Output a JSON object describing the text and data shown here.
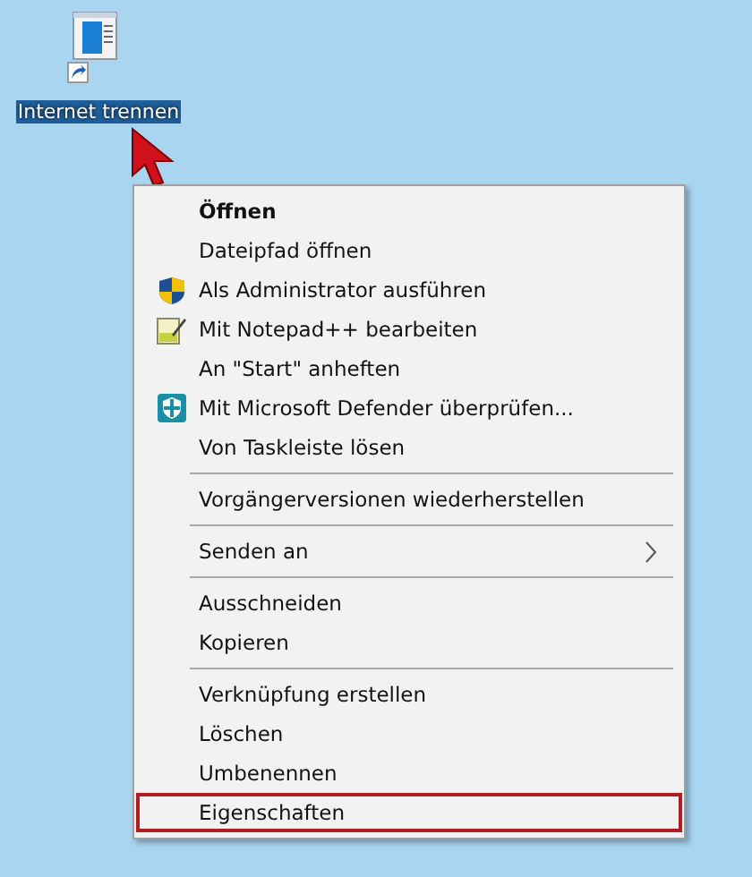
{
  "desktop_icon": {
    "label": "Internet trennen",
    "selected": true
  },
  "context_menu": {
    "groups": [
      [
        {
          "label": "Öffnen",
          "default": true,
          "kind": "plain",
          "submenu": false,
          "highlighted": false
        },
        {
          "label": "Dateipfad öffnen",
          "default": false,
          "kind": "plain",
          "submenu": false,
          "highlighted": false
        },
        {
          "label": "Als Administrator ausführen",
          "default": false,
          "kind": "shield",
          "submenu": false,
          "highlighted": false
        },
        {
          "label": "Mit Notepad++ bearbeiten",
          "default": false,
          "kind": "notepad",
          "submenu": false,
          "highlighted": false
        },
        {
          "label": "An \"Start\" anheften",
          "default": false,
          "kind": "plain",
          "submenu": false,
          "highlighted": false
        },
        {
          "label": "Mit Microsoft Defender überprüfen...",
          "default": false,
          "kind": "defender",
          "submenu": false,
          "highlighted": false
        },
        {
          "label": "Von Taskleiste lösen",
          "default": false,
          "kind": "plain",
          "submenu": false,
          "highlighted": false
        }
      ],
      [
        {
          "label": "Vorgängerversionen wiederherstellen",
          "default": false,
          "kind": "plain",
          "submenu": false,
          "highlighted": false
        }
      ],
      [
        {
          "label": "Senden an",
          "default": false,
          "kind": "plain",
          "submenu": true,
          "highlighted": false
        }
      ],
      [
        {
          "label": "Ausschneiden",
          "default": false,
          "kind": "plain",
          "submenu": false,
          "highlighted": false
        },
        {
          "label": "Kopieren",
          "default": false,
          "kind": "plain",
          "submenu": false,
          "highlighted": false
        }
      ],
      [
        {
          "label": "Verknüpfung erstellen",
          "default": false,
          "kind": "plain",
          "submenu": false,
          "highlighted": false
        },
        {
          "label": "Löschen",
          "default": false,
          "kind": "plain",
          "submenu": false,
          "highlighted": false
        },
        {
          "label": "Umbenennen",
          "default": false,
          "kind": "plain",
          "submenu": false,
          "highlighted": false
        },
        {
          "label": "Eigenschaften",
          "default": false,
          "kind": "plain",
          "submenu": false,
          "highlighted": true
        }
      ]
    ]
  }
}
